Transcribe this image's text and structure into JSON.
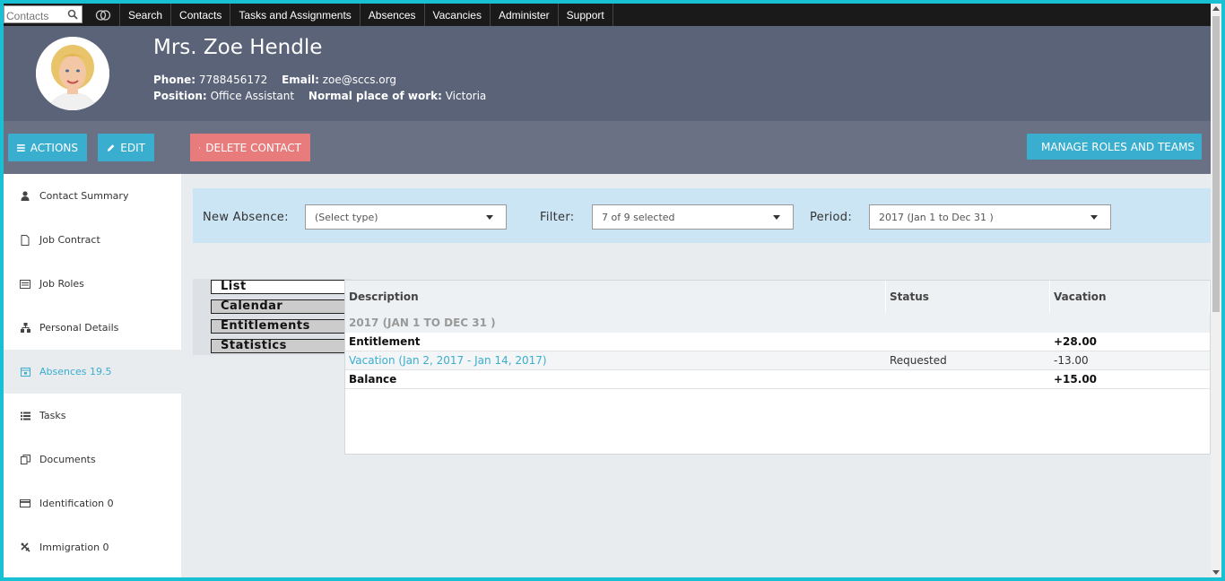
{
  "topnav": {
    "search_placeholder": "Contacts",
    "items": [
      "Search",
      "Contacts",
      "Tasks and Assignments",
      "Absences",
      "Vacancies",
      "Administer",
      "Support"
    ]
  },
  "header": {
    "name": "Mrs. Zoe Hendle",
    "phone_label": "Phone:",
    "phone": "7788456172",
    "email_label": "Email:",
    "email": "zoe@sccs.org",
    "position_label": "Position:",
    "position": "Office Assistant",
    "workplace_label": "Normal place of work:",
    "workplace": "Victoria"
  },
  "actions": {
    "actions_label": "ACTIONS",
    "edit_label": "EDIT",
    "delete_label": "DELETE CONTACT",
    "manage_label": "MANAGE ROLES AND TEAMS"
  },
  "sidebar": {
    "items": [
      {
        "label": "Contact Summary",
        "icon": "user-icon"
      },
      {
        "label": "Job Contract",
        "icon": "document-icon"
      },
      {
        "label": "Job Roles",
        "icon": "card-icon"
      },
      {
        "label": "Personal Details",
        "icon": "sitemap-icon"
      },
      {
        "label": "Absences 19.5",
        "icon": "calendar-icon"
      },
      {
        "label": "Tasks",
        "icon": "list-icon"
      },
      {
        "label": "Documents",
        "icon": "copy-icon"
      },
      {
        "label": "Identification 0",
        "icon": "id-card-icon"
      },
      {
        "label": "Immigration 0",
        "icon": "plane-icon"
      }
    ]
  },
  "filters": {
    "new_absence_label": "New Absence:",
    "new_absence_value": "(Select type)",
    "filter_label": "Filter:",
    "filter_value": "7 of 9 selected",
    "period_label": "Period:",
    "period_value": "2017 (Jan 1 to Dec 31 )"
  },
  "view_tabs": [
    "List",
    "Calendar",
    "Entitlements",
    "Statistics"
  ],
  "table": {
    "headers": [
      "Description",
      "Status",
      "Vacation"
    ],
    "period_heading": "2017 (JAN 1 TO DEC 31 )",
    "rows": [
      {
        "description": "Entitlement",
        "status": "",
        "vacation": "+28.00"
      },
      {
        "description": "Vacation (Jan 2, 2017 - Jan 14, 2017)",
        "status": "Requested",
        "vacation": "-13.00"
      },
      {
        "description": "Balance",
        "status": "",
        "vacation": "+15.00"
      }
    ]
  }
}
